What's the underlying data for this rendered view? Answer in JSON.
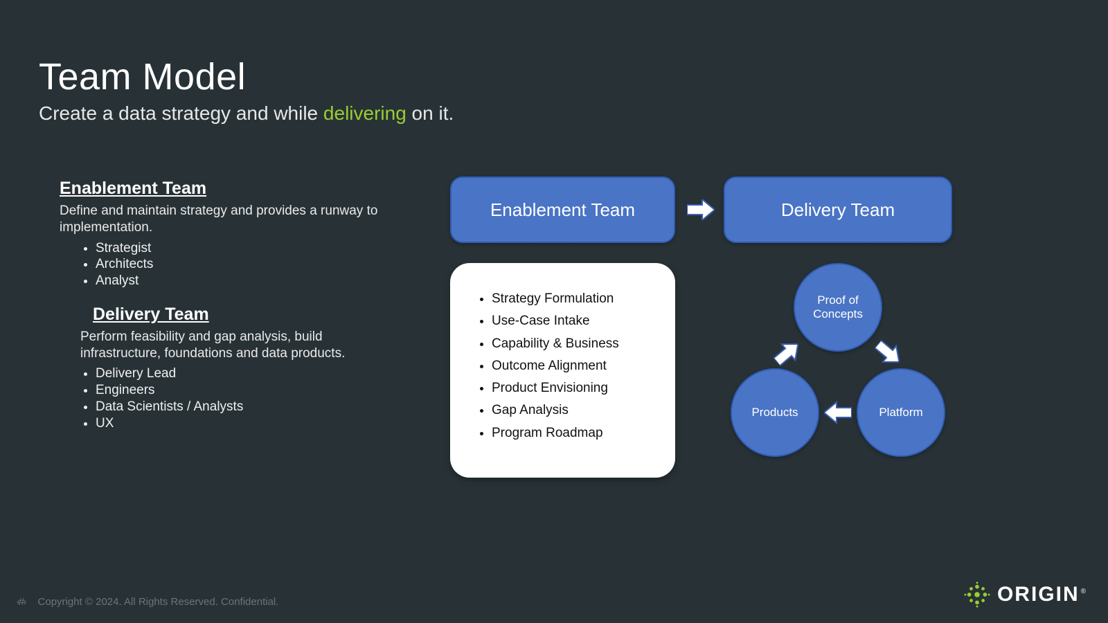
{
  "title": "Team Model",
  "subtitle_pre": "Create a data strategy and while ",
  "subtitle_accent": "delivering",
  "subtitle_post": " on it.",
  "enablement": {
    "heading": "Enablement Team",
    "desc": "Define and maintain strategy and provides a runway to implementation.",
    "roles": [
      "Strategist",
      "Architects",
      "Analyst"
    ]
  },
  "delivery": {
    "heading": "Delivery Team",
    "desc": "Perform feasibility and gap analysis, build infrastructure, foundations and data products.",
    "roles": [
      "Delivery Lead",
      "Engineers",
      "Data Scientists / Analysts",
      "UX"
    ]
  },
  "pill_enable": "Enablement Team",
  "pill_delivery": "Delivery Team",
  "card_items": [
    "Strategy Formulation",
    "Use-Case Intake",
    "Capability & Business",
    "Outcome Alignment",
    "Product Envisioning",
    "Gap Analysis",
    "Program Roadmap"
  ],
  "cycle": {
    "top": "Proof of Concepts",
    "bottom_left": "Products",
    "bottom_right": "Platform"
  },
  "footer": {
    "pagemark": "‹#›",
    "text": "Copyright © 2024.  All Rights Reserved.   Confidential."
  },
  "brand": "ORIGIN",
  "colors": {
    "accent_green": "#9ACD32",
    "pill_blue": "#4a74c5"
  }
}
